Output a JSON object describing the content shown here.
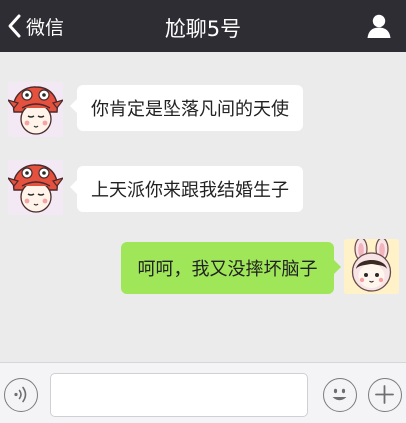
{
  "header": {
    "back_label": "微信",
    "title": "尬聊5号",
    "back_icon": "chevron-left-icon",
    "profile_icon": "person-icon"
  },
  "messages": [
    {
      "side": "left",
      "text": "你肯定是坠落凡间的天使",
      "avatar": "fox-girl-avatar"
    },
    {
      "side": "left",
      "text": "上天派你来跟我结婚生子",
      "avatar": "fox-girl-avatar"
    },
    {
      "side": "right",
      "text": "呵呵，我又没摔坏脑子",
      "avatar": "bunny-girl-avatar"
    }
  ],
  "input_bar": {
    "voice_icon": "voice-icon",
    "emoji_icon": "emoji-icon",
    "plus_icon": "plus-icon",
    "input_value": ""
  },
  "colors": {
    "header_bg": "#2d2d33",
    "chat_bg": "#ebebeb",
    "sent_bubble": "#9fe658",
    "received_bubble": "#ffffff"
  }
}
